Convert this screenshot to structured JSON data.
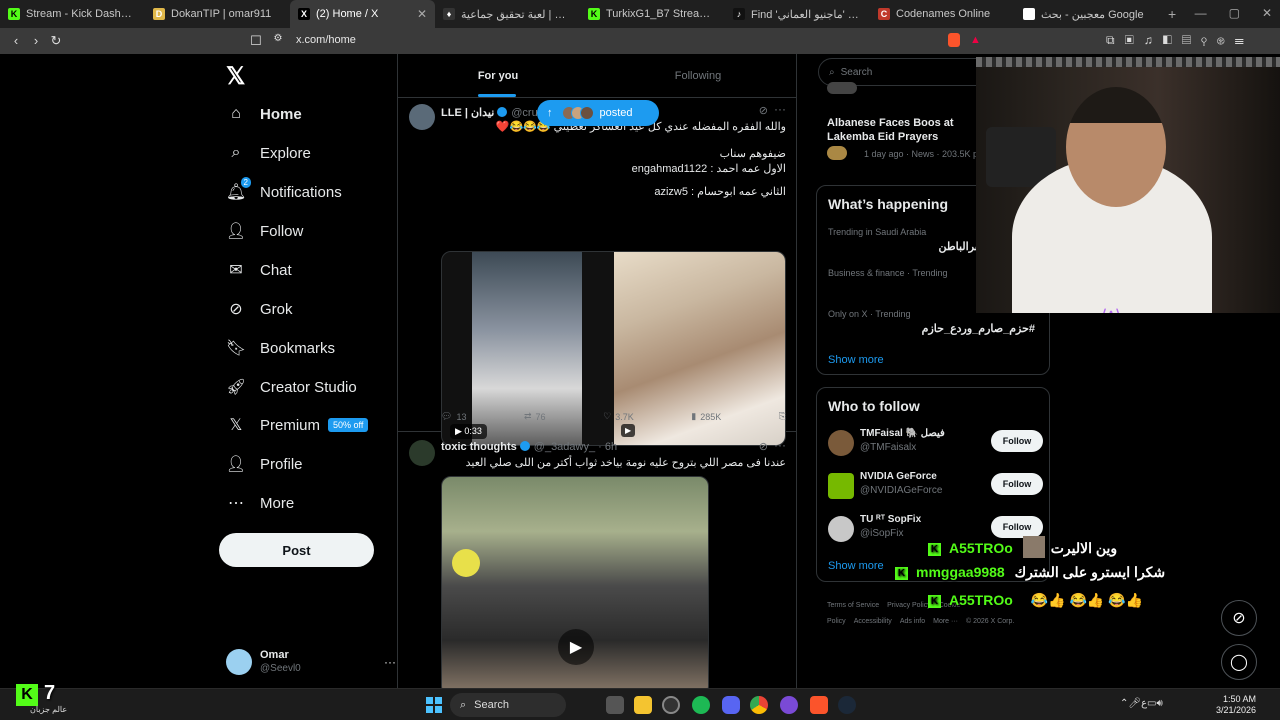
{
  "browser": {
    "tabs": [
      {
        "title": "Stream - Kick Dashboard",
        "favicon": "kick-icon",
        "color": "#53fc18",
        "glyph": "K",
        "active": false
      },
      {
        "title": "DokanTIP | omar911",
        "favicon": "dokantip-icon",
        "color": "#e0b84a",
        "glyph": "D",
        "active": false
      },
      {
        "title": "(2) Home / X",
        "favicon": "x-icon",
        "color": "#000000",
        "glyph": "X",
        "active": true
      },
      {
        "title": "مكشوف | لعبة تحقيق جماعية",
        "favicon": "game-icon",
        "color": "#333333",
        "glyph": "♦",
        "active": false
      },
      {
        "title": "TurkixG1_B7 Stream - Watch Live",
        "favicon": "kick-icon",
        "color": "#53fc18",
        "glyph": "K",
        "active": false
      },
      {
        "title": "Find 'ماجنيو العماني' on TikTok",
        "favicon": "tiktok-icon",
        "color": "#111111",
        "glyph": "♪",
        "active": false
      },
      {
        "title": "Codenames Online",
        "favicon": "codenames-icon",
        "color": "#c0392b",
        "glyph": "C",
        "active": false
      },
      {
        "title": "معجبين - بحث Google",
        "favicon": "google-icon",
        "color": "#ffffff",
        "glyph": "G",
        "active": false
      }
    ],
    "url": "x.com/home"
  },
  "sidebar": {
    "logo": "𝕏",
    "items": [
      {
        "label": "Home",
        "icon": "home-icon",
        "glyph": "⌂",
        "bold": true
      },
      {
        "label": "Explore",
        "icon": "search-icon",
        "glyph": "⌕"
      },
      {
        "label": "Notifications",
        "icon": "bell-icon",
        "glyph": "🔔︎",
        "badge": "2"
      },
      {
        "label": "Follow",
        "icon": "add-user-icon",
        "glyph": "👤︎"
      },
      {
        "label": "Chat",
        "icon": "mail-icon",
        "glyph": "✉"
      },
      {
        "label": "Grok",
        "icon": "grok-icon",
        "glyph": "⊘"
      },
      {
        "label": "Bookmarks",
        "icon": "bookmark-icon",
        "glyph": "🔖︎"
      },
      {
        "label": "Creator Studio",
        "icon": "rocket-icon",
        "glyph": "🚀︎"
      },
      {
        "label": "Premium",
        "icon": "x-premium-icon",
        "glyph": "𝕏",
        "extra": "50% off"
      },
      {
        "label": "Profile",
        "icon": "person-icon",
        "glyph": "👤︎"
      },
      {
        "label": "More",
        "icon": "more-circle-icon",
        "glyph": "⋯"
      }
    ],
    "post_label": "Post",
    "profile": {
      "name": "Omar",
      "handle": "@Seevl0",
      "more": "···"
    }
  },
  "feed": {
    "tabs": [
      "For you",
      "Following"
    ],
    "posted_pill": "posted",
    "tweets": [
      {
        "name": "LLE | نيدان",
        "handle": "@cruvt",
        "lines": [
          "والله الفقره المفضله عندي كل عيد العساكر تعطيني 😂😂😂❤️",
          "",
          "ضيفوهم سناب",
          "الاول عمه احمد : engahmad1122",
          "",
          "الثاني عمه ابوحسام : azizw5"
        ],
        "video_time": "0:33",
        "stats": {
          "replies": "13",
          "reposts": "76",
          "likes": "3.7K",
          "views": "285K"
        }
      },
      {
        "name": "toxic thoughts",
        "handle": "@_3adawy_ · 6h",
        "lines": [
          "عندنا فى مصر اللي بتروح عليه نومة بياخد ثواب أكتر من اللى صلي العيد"
        ]
      }
    ]
  },
  "right": {
    "search_placeholder": "Search",
    "news": {
      "title": "Albanese Faces Boos at Lakemba Eid Prayers",
      "meta": "1 day ago · News · 203.5K posts"
    },
    "happening": {
      "title": "What’s happening",
      "trends": [
        {
          "meta": "Trending in Saudi Arabia",
          "name": "#الضحيك_حفرالباطن"
        },
        {
          "meta": "Business & finance · Trending",
          "name": "ع"
        },
        {
          "meta": "Only on X · Trending",
          "name": "#حزم_صارم_وردع_حازم"
        }
      ],
      "show_more": "Show more"
    },
    "who_to_follow": {
      "title": "Who to follow",
      "accounts": [
        {
          "name": "TMFaisal 🐘 فيصل",
          "handle": "@TMFaisalx",
          "color": "#7a5a3a"
        },
        {
          "name": "NVIDIA GeForce",
          "handle": "@NVIDIAGeForce",
          "color": "#76b900"
        },
        {
          "name": "TU ᴿᵀ SopFix",
          "handle": "@iSopFix",
          "color": "#c8c8c8"
        }
      ],
      "follow_label": "Follow",
      "show_more": "Show more"
    },
    "footer": [
      "Terms of Service",
      "Privacy Policy",
      "Cookie Policy",
      "Accessibility",
      "Ads info",
      "More ···",
      "© 2026 X Corp."
    ]
  },
  "overlay": {
    "chat": [
      {
        "user": "A55TROo",
        "text": "وين الاليرت"
      },
      {
        "user": "mmggaa9988",
        "text": "شكرا ايسترو على الشترك"
      },
      {
        "user": "A55TROo",
        "text": "😂👍 😂👍 😂👍"
      }
    ],
    "kick_count": "7",
    "kick_caption": "عالم جزبان"
  },
  "taskbar": {
    "search": "Search",
    "time": "1:50 AM",
    "date": "3/21/2026"
  }
}
